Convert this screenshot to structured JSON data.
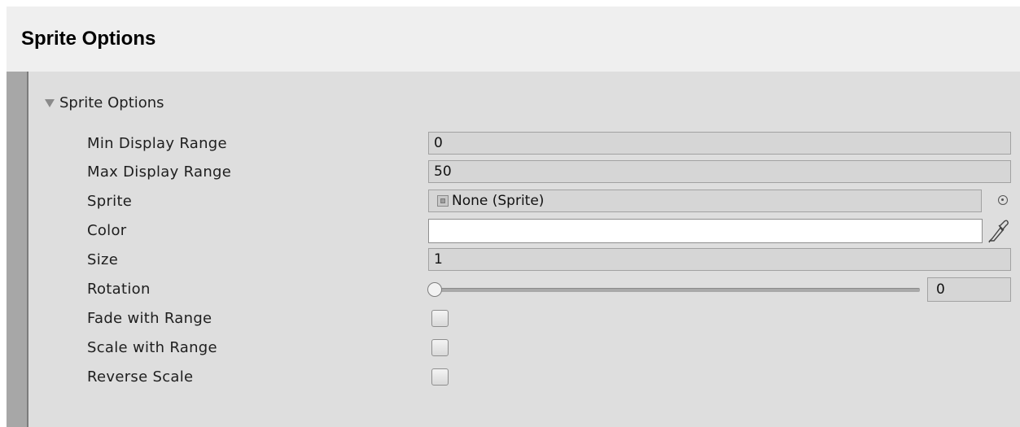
{
  "header": {
    "title": "Sprite Options"
  },
  "foldout": {
    "label": "Sprite Options",
    "expanded": true
  },
  "fields": {
    "min_display_range": {
      "label": "Min Display Range",
      "value": "0"
    },
    "max_display_range": {
      "label": "Max Display Range",
      "value": "50"
    },
    "sprite": {
      "label": "Sprite",
      "value": "None (Sprite)"
    },
    "color": {
      "label": "Color",
      "value": "#ffffff"
    },
    "size": {
      "label": "Size",
      "value": "1"
    },
    "rotation": {
      "label": "Rotation",
      "value": "0",
      "slider_fraction": 0
    },
    "fade_with_range": {
      "label": "Fade with Range",
      "checked": false
    },
    "scale_with_range": {
      "label": "Scale with Range",
      "checked": false
    },
    "reverse_scale": {
      "label": "Reverse Scale",
      "checked": false
    }
  },
  "icons": [
    "foldout-arrow-icon",
    "sprite-object-icon",
    "object-picker-icon",
    "eyedropper-icon"
  ]
}
